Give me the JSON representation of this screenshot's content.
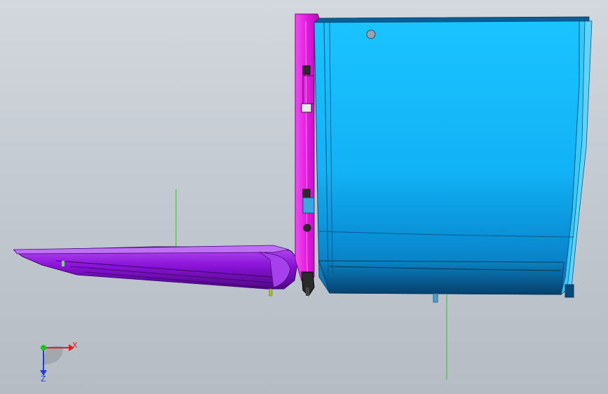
{
  "view": {
    "background_top": "#d3d8de",
    "background_bottom": "#b6bcc4"
  },
  "model": {
    "tray_color": "#8a13d8",
    "tray_dark": "#5a0a8e",
    "hinge_color": "#e418e0",
    "cabinet_light": "#14c2ff",
    "cabinet_mid": "#0a9be0",
    "cabinet_dark": "#064a7a",
    "axis_line_color": "#22cc22"
  },
  "triad": {
    "x_label": "X",
    "z_label": "Z",
    "x_color": "#e02020",
    "z_color": "#2040d0",
    "y_color": "#20c020"
  }
}
